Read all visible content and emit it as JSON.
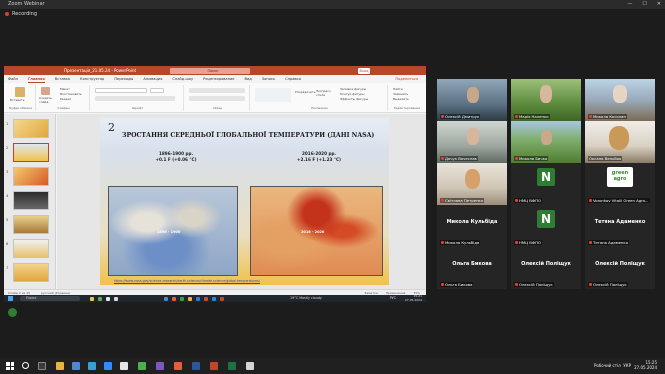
{
  "zoom": {
    "title": "Zoom Webinar",
    "recording": "Recording",
    "win_controls": [
      "—",
      "☐",
      "✕"
    ]
  },
  "ppt": {
    "title": "Презентація_21.05.24 - PowerPoint",
    "search": "Поиск",
    "enter": "Вход",
    "menu": [
      "Файл",
      "Главная",
      "Вставка",
      "Конструктор",
      "Переходы",
      "Анимация",
      "Слайд-шоу",
      "Рецензирование",
      "Вид",
      "Запись",
      "Справка"
    ],
    "active_menu": "Главная",
    "share": "Поделиться",
    "ribbon": {
      "paste": "Вставить",
      "create_slide": "Создать слайд",
      "layout": "Макет",
      "reset": "Восстановить",
      "section": "Раздел",
      "clipboard_label": "Буфер обмена",
      "slides_label": "Слайды",
      "font_label": "Шрифт",
      "paragraph_label": "Абзац",
      "arrange": "Упорядочить",
      "quick_styles": "Экспресс-стили",
      "fill": "Заливка фигуры",
      "outline": "Контур фигуры",
      "effects": "Эффекты фигуры",
      "drawing_label": "Рисование",
      "find": "Найти",
      "replace": "Заменить",
      "select": "Выделить",
      "editing_label": "Редактирование"
    },
    "thumb_numbers": [
      "1",
      "2",
      "3",
      "4",
      "5",
      "6",
      "7"
    ],
    "selected_slide": 2,
    "status": {
      "slide": "Слайд 2 из 15",
      "language": "русский (Украина)",
      "notes": "Заметки",
      "comments": "Примечания",
      "zoom": "75%"
    }
  },
  "slide": {
    "number": "2",
    "title": "ЗРОСТАННЯ СЕРЕДНЬОЇ ГЛОБАЛЬНОЇ ТЕМПЕРАТУРИ (ДАНІ NASA)",
    "left_caption_line1": "1896-1900 рр.",
    "left_caption_line2": "+0.1 F  (+0.06 °C)",
    "right_caption_line1": "2016-2020 рр.",
    "right_caption_line2": "+2.16 F  (+1.23 °C)",
    "left_map_label": "1896 - 1900",
    "right_map_label": "2016 - 2020",
    "link": "https://www.nasa.gov/science-research/earth-science/climate-science/global-temperatures/"
  },
  "remote_taskbar": {
    "search": "Поиск",
    "weather": "19°C  Mostly cloudy",
    "lang": "РУС",
    "time": "15:21",
    "date": "27.05.2024"
  },
  "gallery": [
    {
      "name": "Олексій Дмитрук",
      "kind": "video",
      "speaker": false
    },
    {
      "name": "Марія Налепко",
      "kind": "video",
      "speaker": false
    },
    {
      "name": "Микола Косолап",
      "kind": "video",
      "speaker": false
    },
    {
      "name": "Дячук Вячеслав",
      "kind": "video",
      "speaker": false
    },
    {
      "name": "Микола Бичко",
      "kind": "video",
      "speaker": false
    },
    {
      "name": "Оксана Вельбая",
      "kind": "video",
      "speaker": true
    },
    {
      "name": "Світлана Петренко",
      "kind": "video",
      "speaker": false
    },
    {
      "name": "НМЦ ВФПО",
      "kind": "avatar",
      "letter": "N",
      "speaker": false
    },
    {
      "name": "Voronkov Vitalii Green Agro...",
      "kind": "logo",
      "logo_text": "green agro",
      "speaker": false
    },
    {
      "name": "Микола Кульбіда",
      "kind": "name",
      "center": "Микола Кульбіда",
      "speaker": false
    },
    {
      "name": "НМЦ ВФПО",
      "kind": "avatar",
      "letter": "N",
      "speaker": false
    },
    {
      "name": "Тетяна Адаменко",
      "kind": "name",
      "center": "Тетяна Адаменко",
      "speaker": false
    },
    {
      "name": "Ольга Бикова",
      "kind": "name",
      "center": "Ольга Бикова",
      "speaker": false
    },
    {
      "name": "Олексій Поліщук",
      "kind": "name",
      "center": "Олексій Поліщук",
      "speaker": false
    },
    {
      "name": "Олексій Поліщук",
      "kind": "name",
      "center": "Олексій Поліщук",
      "speaker": false
    }
  ],
  "win_taskbar": {
    "desktop": "Робочий стіл",
    "lang": "УКР",
    "time": "15:25",
    "date": "27.05.2024"
  },
  "colors": {
    "ppt_accent": "#b7472a",
    "speaker_outline": "#f6d52c",
    "avatar_green": "#2e7d32"
  }
}
